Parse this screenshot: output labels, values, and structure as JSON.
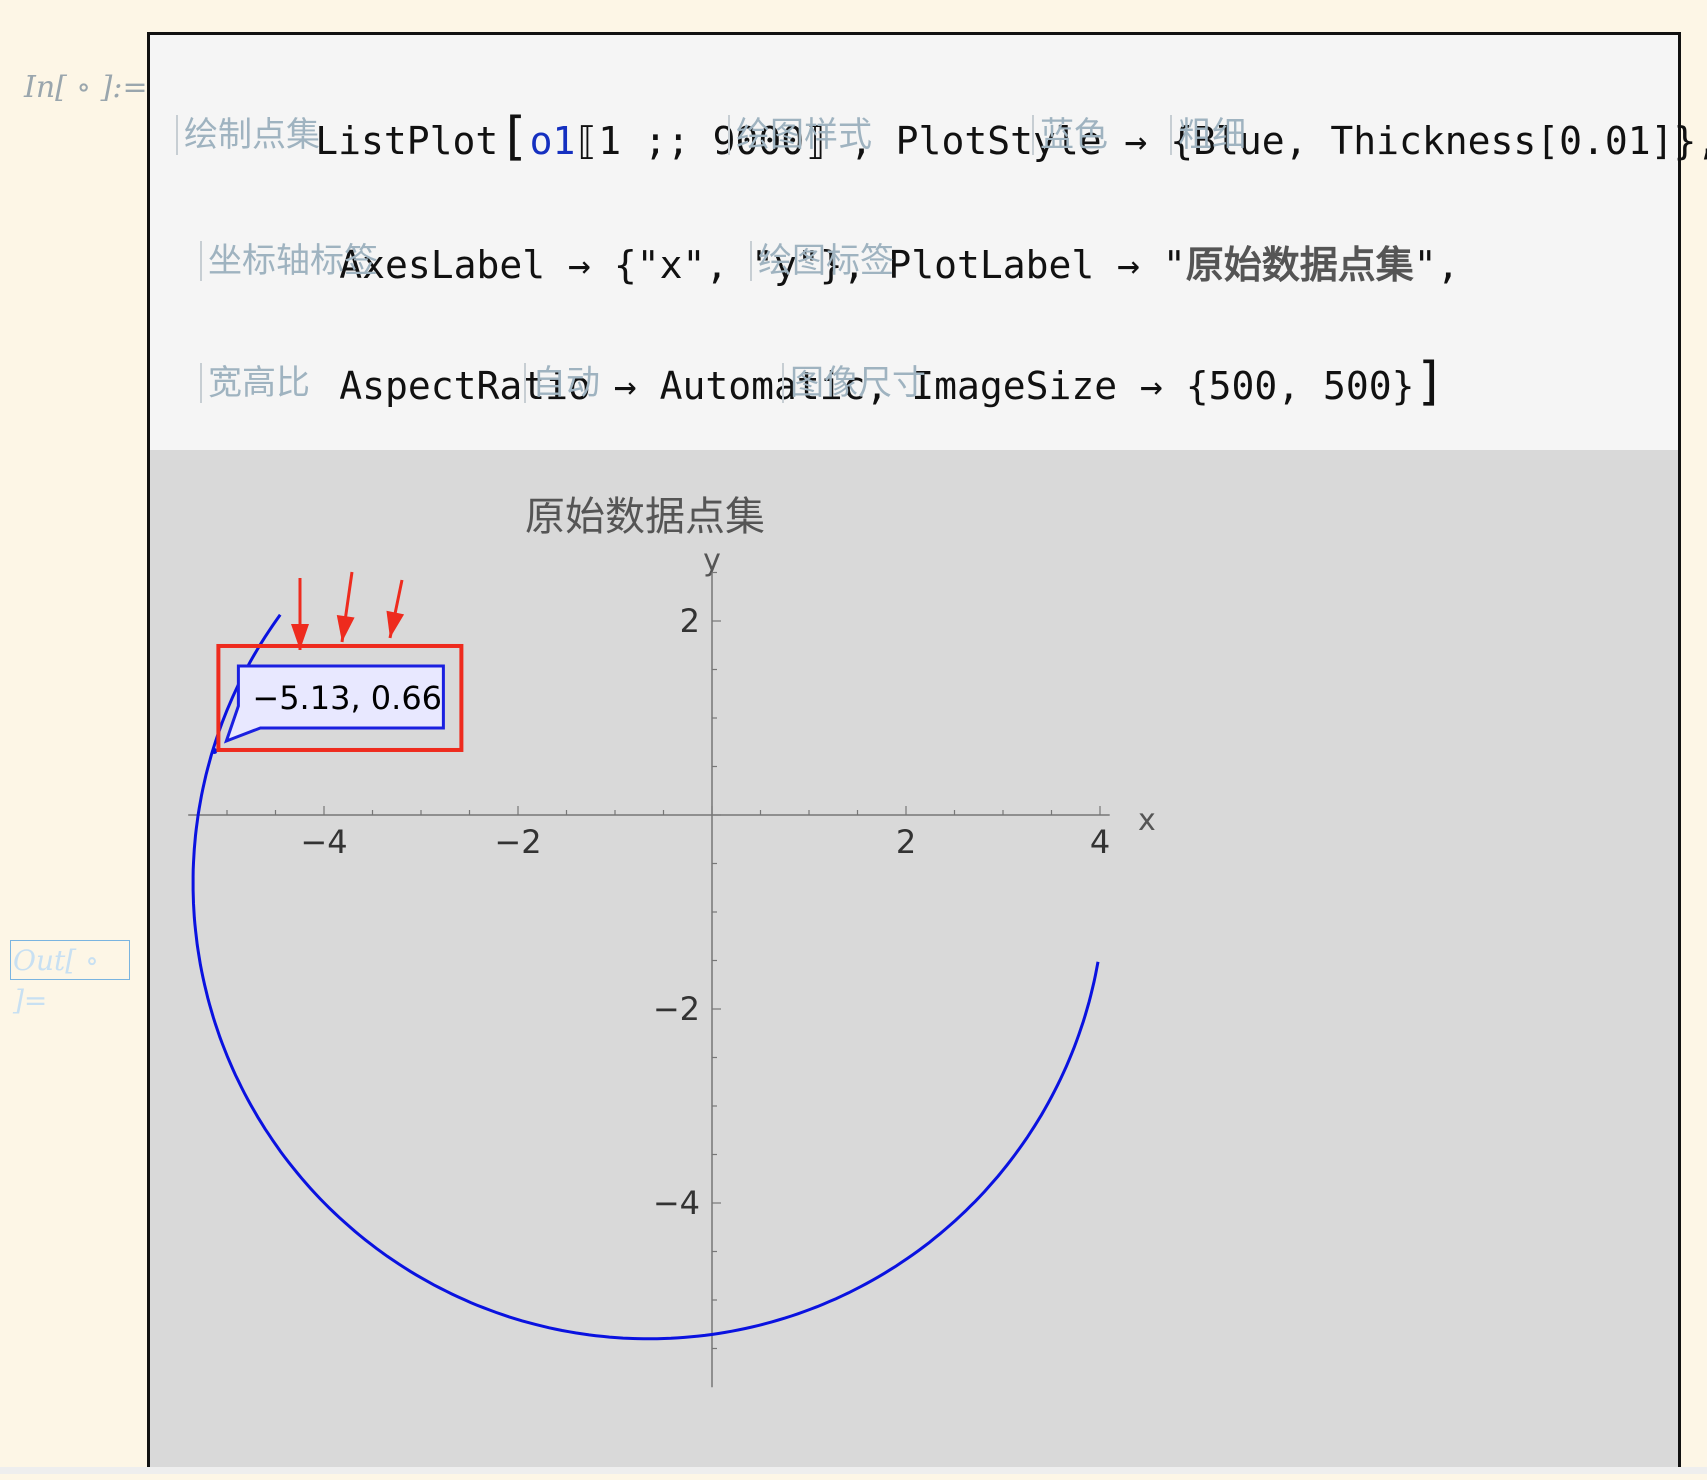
{
  "cell": {
    "in_label": "In[ ∘ ]:=",
    "out_label": "Out[ ∘ ]="
  },
  "code": {
    "line1": {
      "fn": "ListPlot",
      "arg": "o1",
      "part": "⟦1 ;; 9000⟧ , PlotStyle → {Blue, Thickness[0.01]},"
    },
    "line2": "AxesLabel → {\"x\", \"y\"}, PlotLabel → \"",
    "line2_label": "原始数据点集",
    "line2_end": "\",",
    "line3": "AspectRatio → Automatic, ImageSize → {500, 500}"
  },
  "hints": {
    "listplot": "绘制点集",
    "plotstyle": "绘图样式",
    "blue": "蓝色",
    "thickness": "粗细",
    "axeslabel": "坐标轴标签",
    "plotlabel": "绘图标签",
    "aspectratio": "宽高比",
    "automatic": "自动",
    "imagesize": "图像尺寸"
  },
  "colors": {
    "curve": "#0a12e0",
    "highlight": "#ee2b1e",
    "tooltip_fill": "#e8e8ff",
    "tooltip_border": "#1a20e0",
    "arrow": "#ee2b1e"
  },
  "chart_data": {
    "type": "line",
    "title": "原始数据点集",
    "xlabel": "x",
    "ylabel": "y",
    "xlim": [
      -5.4,
      4.1
    ],
    "ylim": [
      -5.9,
      2.5
    ],
    "x_ticks": [
      -4,
      -2,
      2,
      4
    ],
    "y_ticks": [
      2,
      -2,
      -4
    ],
    "circle": {
      "cx": -0.65,
      "cy": -0.7,
      "r": 4.7
    },
    "arc_start": {
      "x": -4.5,
      "y": 2.1
    },
    "arc_end": {
      "x": 3.9,
      "y": -1.5
    },
    "tooltip_point": {
      "x": -5.13,
      "y": 0.66
    },
    "tooltip_text": "−5.13, 0.66"
  }
}
